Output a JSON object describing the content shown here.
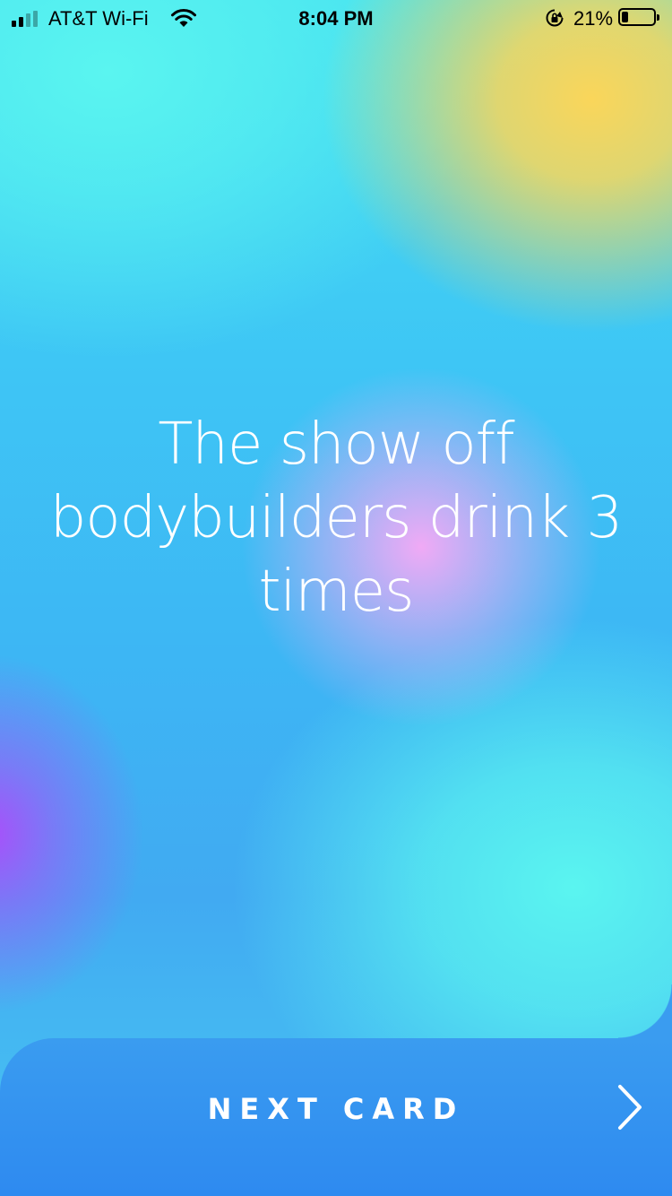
{
  "status_bar": {
    "carrier": "AT&T Wi-Fi",
    "time": "8:04 PM",
    "battery_percent": "21%",
    "battery_level": 0.21,
    "signal_bars": 2,
    "icons": [
      "signal-icon",
      "wifi-icon",
      "rotation-lock-icon",
      "battery-icon"
    ]
  },
  "card": {
    "text": "The show off bodybuilders drink 3 times"
  },
  "footer": {
    "next_label": "NEXT CARD",
    "next_icon": "chevron-right-icon"
  },
  "colors": {
    "text": "#ffffff",
    "button_bg": "#2e8af0",
    "accent_yellow": "#fad65a",
    "accent_pink": "#f0aaf5",
    "accent_purple": "#a850fa",
    "accent_cyan": "#5af5f0"
  }
}
